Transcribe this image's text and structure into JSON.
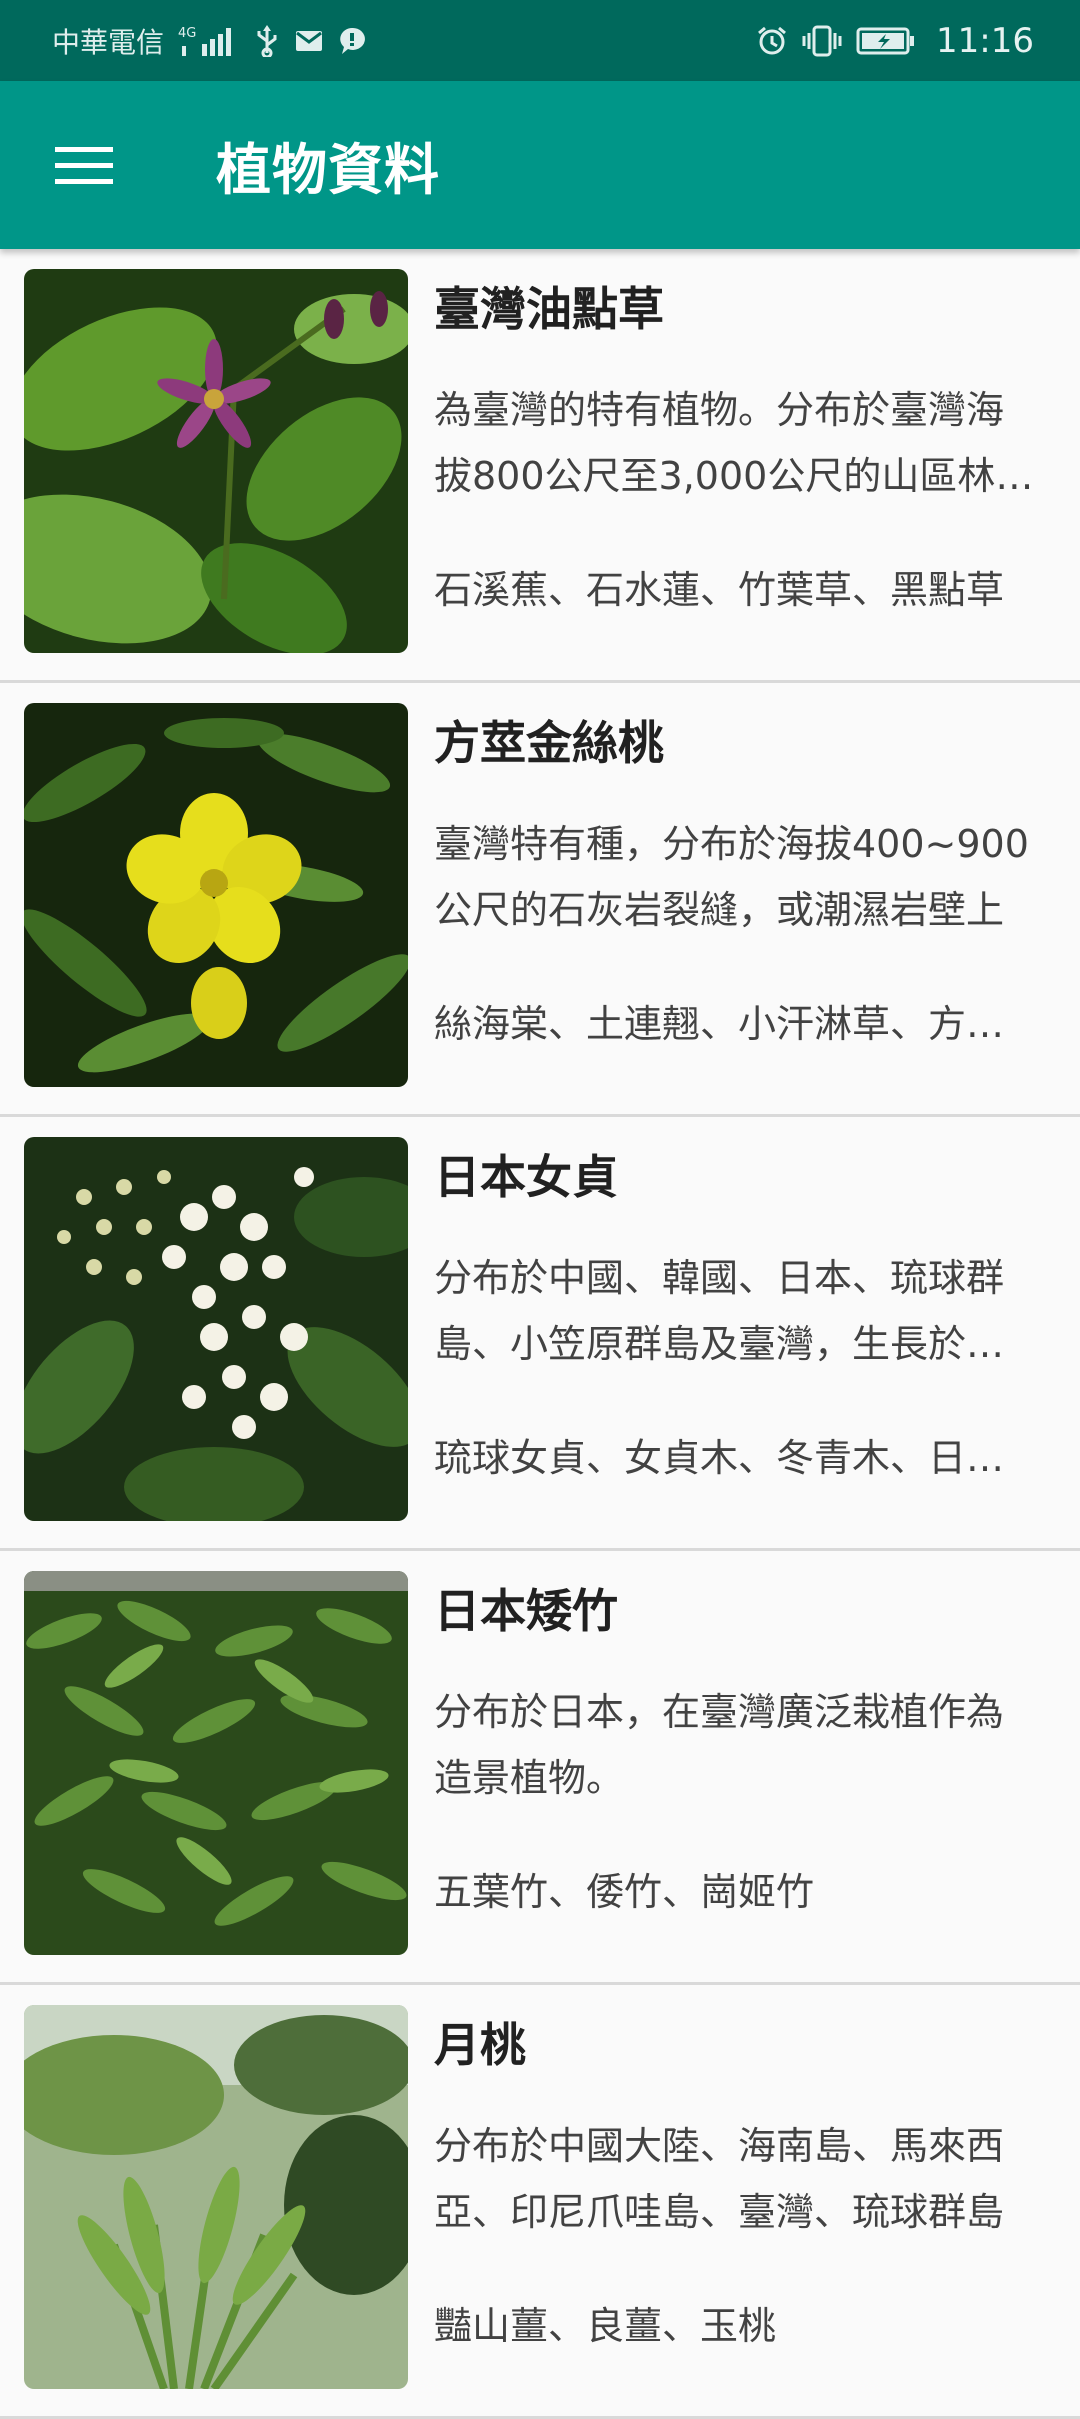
{
  "status_bar": {
    "carrier": "中華電信",
    "network": "4G",
    "time": "11:16",
    "icons": [
      "signal-icon",
      "usb-icon",
      "mail-icon",
      "chat-icon",
      "alarm-icon",
      "vibrate-icon",
      "battery-charging-icon"
    ]
  },
  "app_bar": {
    "title": "植物資料",
    "menu_icon": "hamburger-menu-icon",
    "color": "#009688",
    "status_color": "#00695c"
  },
  "plants": [
    {
      "name": "臺灣油點草",
      "description": "為臺灣的特有植物。分布於臺灣海拔800公尺至3,000公尺的山區林下或潮濕處",
      "aliases": "石溪蕉、石水蓮、竹葉草、黑點草"
    },
    {
      "name": "方莖金絲桃",
      "description": "臺灣特有種，分布於海拔400~900公尺的石灰岩裂縫，或潮濕岩壁上",
      "aliases": "絲海棠、土連翹、小汗淋草、方莖金絲桃"
    },
    {
      "name": "日本女貞",
      "description": "分布於中國、韓國、日本、琉球群島、小笠原群島及臺灣，生長於低海拔森林",
      "aliases": "琉球女貞、女貞木、冬青木、日本女貞"
    },
    {
      "name": "日本矮竹",
      "description": "分布於日本，在臺灣廣泛栽植作為造景植物。",
      "aliases": "五葉竹、倭竹、崗姬竹"
    },
    {
      "name": "月桃",
      "description": "分布於中國大陸、海南島、馬來西亞、印尼爪哇島、臺灣、琉球群島",
      "aliases": "豔山薑、良薑、玉桃"
    }
  ]
}
